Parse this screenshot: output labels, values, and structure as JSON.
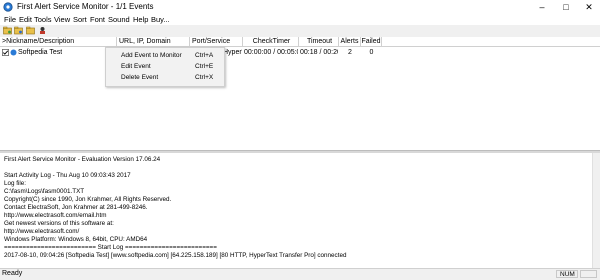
{
  "window": {
    "title": "First Alert Service Monitor - 1/1 Events"
  },
  "menu": [
    "File",
    "Edit",
    "Tools",
    "View",
    "Sort",
    "Font",
    "Sound",
    "Help",
    "Buy..."
  ],
  "columns": [
    ">Nickname/Description",
    "URL, IP, Domain",
    "Port/Service",
    "CheckTimer",
    "Timeout",
    "Alerts",
    "Failed"
  ],
  "rows": [
    {
      "nickname": "Softpedia Test",
      "url": "",
      "port": "80 HTTP, HyperT...",
      "checktimer": "00:00:00 / 00:05:00",
      "timeout": "00:18 / 00:20",
      "alerts": "2",
      "failed": "0",
      "checked": true
    }
  ],
  "context_menu": [
    {
      "label": "Add Event to Monitor",
      "shortcut": "Ctrl+A"
    },
    {
      "label": "Edit Event",
      "shortcut": "Ctrl+E"
    },
    {
      "label": "Delete Event",
      "shortcut": "Ctrl+X"
    }
  ],
  "log": [
    "First Alert Service Monitor - Evaluation Version 17.06.24",
    "",
    "Start Activity Log - Thu Aug 10 09:03:43 2017",
    "Log file:",
    "C:\\fasm\\Logs\\fasm0001.TXT",
    "Copyright(C) since 1990, Jon Krahmer, All Rights Reserved.",
    "Contact ElectraSoft, Jon Krahmer at 281-499-8246.",
    "http://www.electrasoft.com/email.htm",
    "Get newest versions of this software at:",
    "http://www.electrasoft.com/",
    "Windows Platform: Windows 8, 64bit, CPU: AMD64",
    "========================= Start Log =========================",
    "2017-08-10, 09:04:26 [Softpedia Test] [www.softpedia.com] [64.225.158.189] [80 HTTP, HyperText Transfer Pro] connected"
  ],
  "status": {
    "text": "Ready",
    "num": "NUM"
  }
}
